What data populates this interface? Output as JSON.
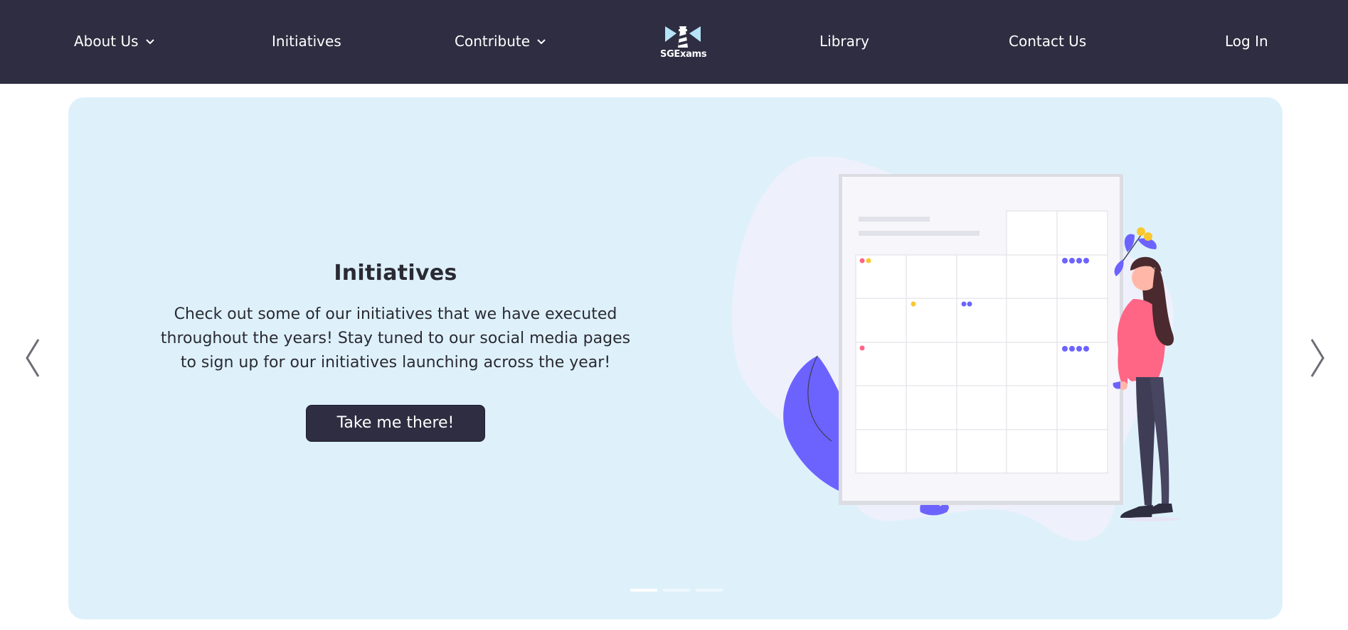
{
  "nav": {
    "about": "About Us",
    "initiatives": "Initiatives",
    "contribute": "Contribute",
    "logo_text": "SGExams",
    "library": "Library",
    "contact": "Contact Us",
    "login": "Log In"
  },
  "slide": {
    "title": "Initiatives",
    "description": "Check out some of our initiatives that we have executed throughout the years! Stay tuned to our social media pages to sign up for our initiatives launching across the year!",
    "button": "Take me there!",
    "indicator_count": 3,
    "active_index": 0
  },
  "icons": {
    "prev": "chevron-left-icon",
    "next": "chevron-right-icon",
    "dropdown": "chevron-down-icon",
    "logo": "lighthouse-icon"
  },
  "colors": {
    "navbar": "#2e2d41",
    "banner": "#def1fb",
    "accent_purple": "#6c63ff",
    "accent_pink": "#ff6584",
    "accent_yellow": "#f9c830"
  }
}
